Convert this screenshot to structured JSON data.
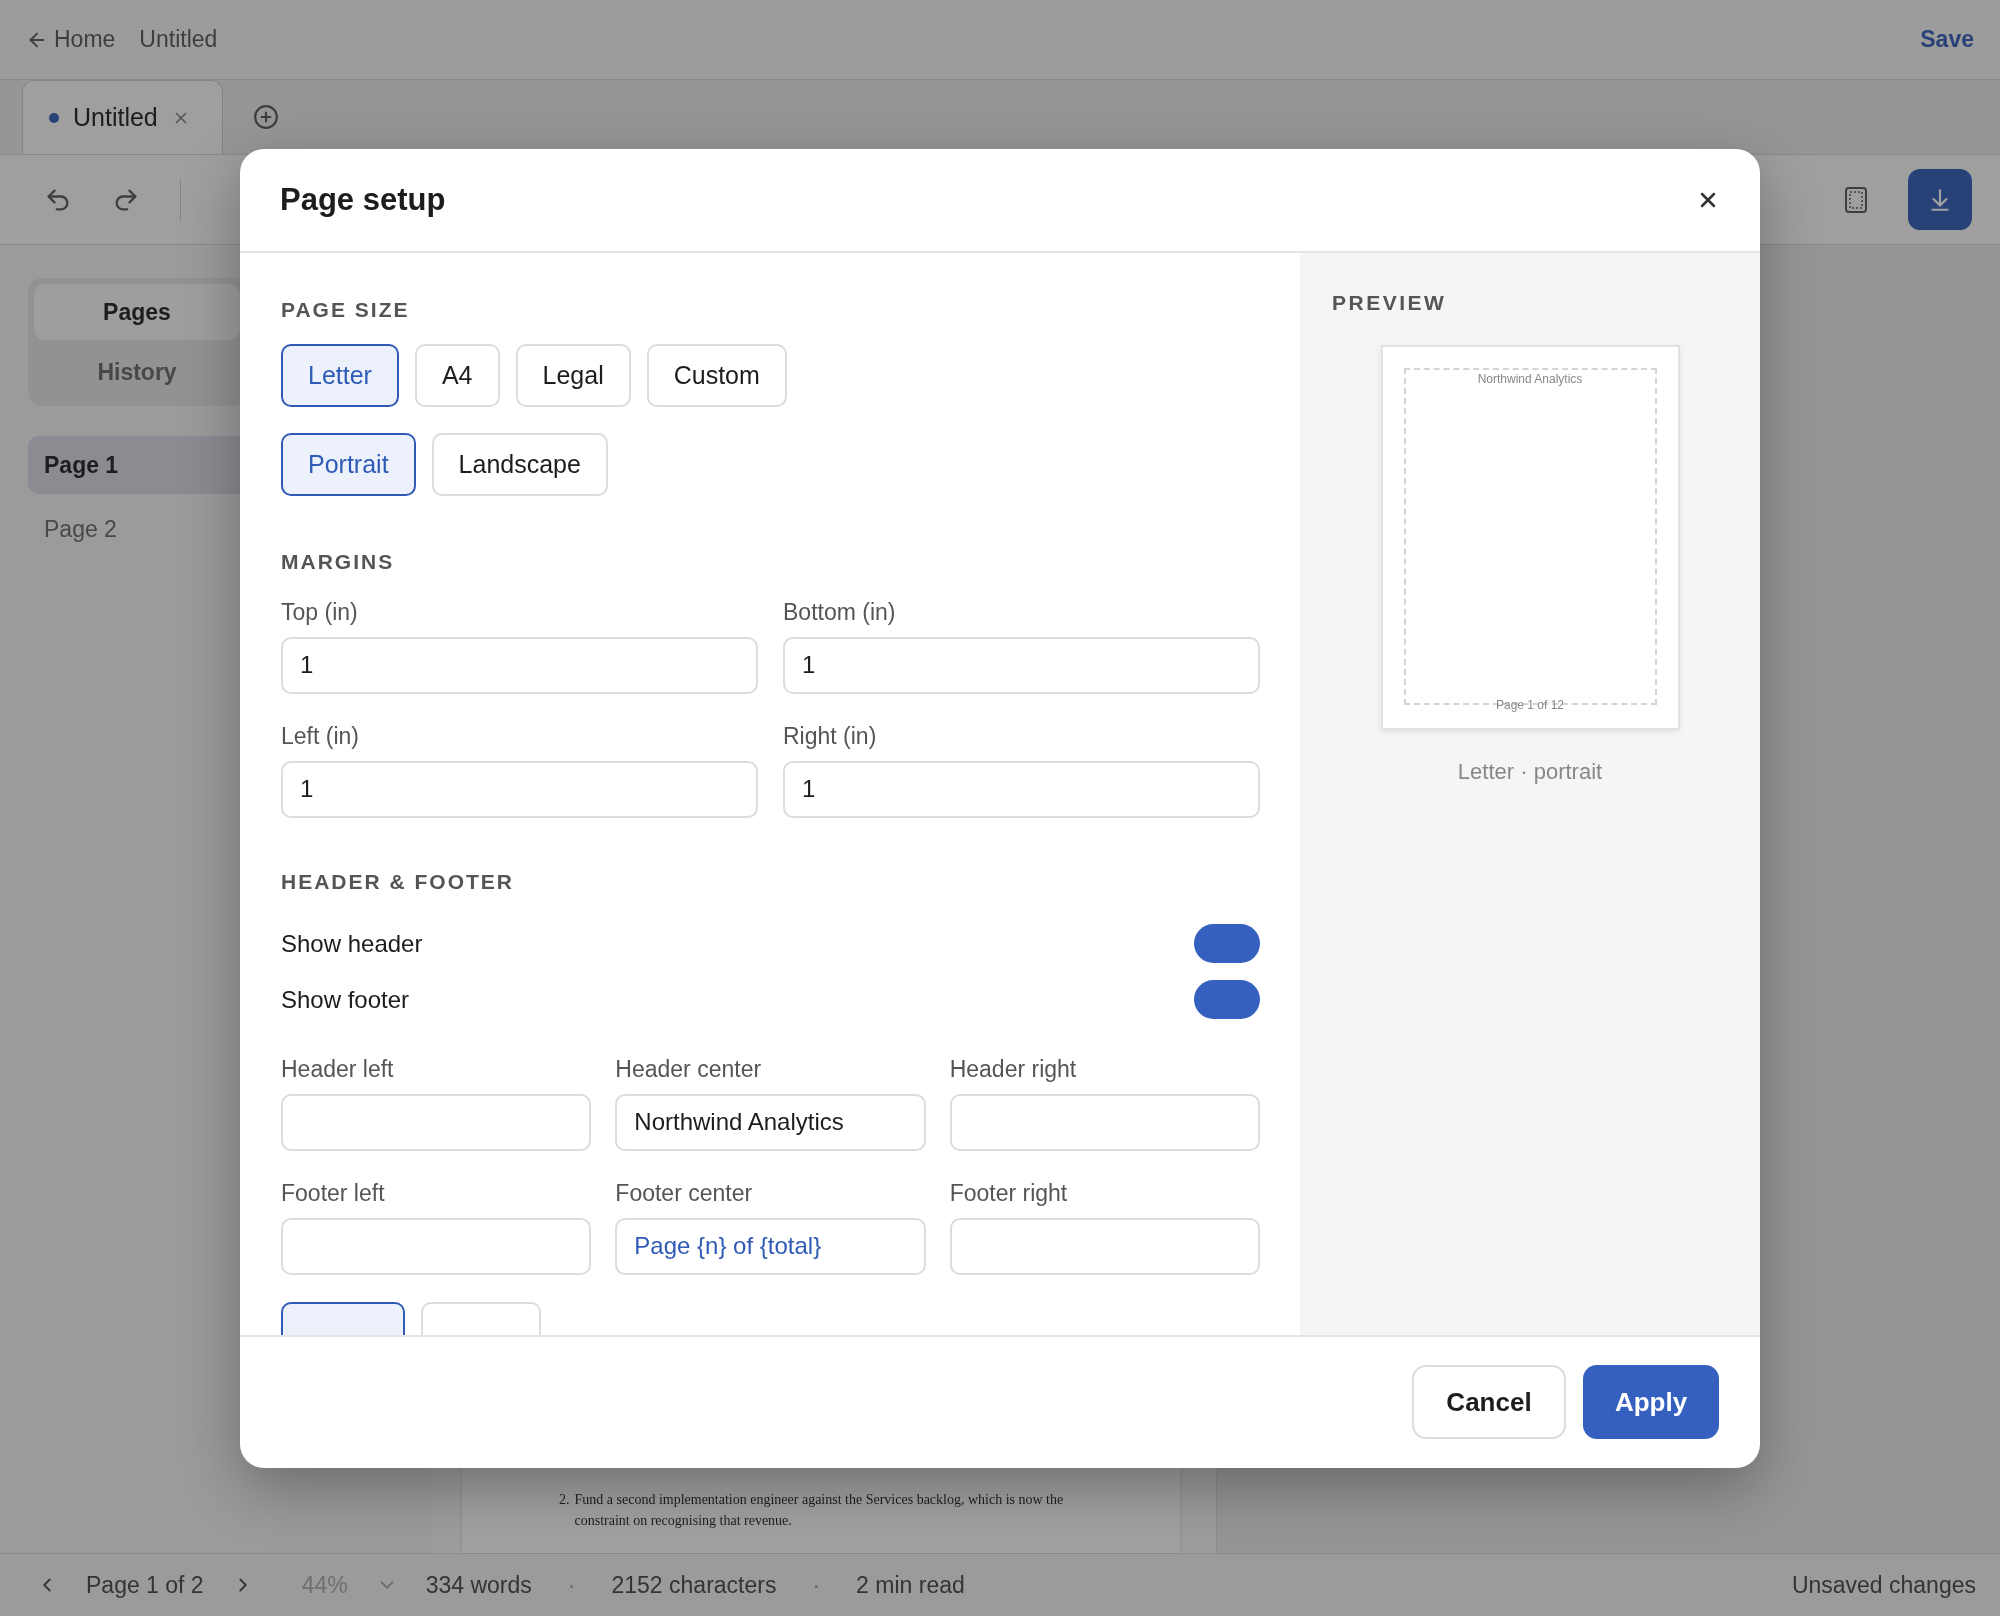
{
  "top_bar": {
    "back_label": "Home",
    "doc_title": "Untitled",
    "save": "Save"
  },
  "tabs": [
    {
      "label": "Untitled",
      "selected": true,
      "unsaved": true
    }
  ],
  "sidebar": {
    "tabs": [
      {
        "label": "Pages",
        "selected": true
      },
      {
        "label": "History",
        "selected": false
      }
    ],
    "pages": [
      {
        "label": "Page 1",
        "selected": true
      },
      {
        "label": "Page 2",
        "selected": false
      }
    ]
  },
  "document": {
    "list": [
      {
        "number": "2.",
        "text": "Fund a second implementation engineer against the Services backlog, which is now the constraint on recognising that revenue."
      }
    ]
  },
  "status_bar": {
    "page": "Page 1 of 2",
    "zoom": {
      "value": "44%",
      "disabled": true
    },
    "stats": [
      {
        "kind": "stat",
        "text": "334 words"
      },
      {
        "kind": "separator",
        "text": "·"
      },
      {
        "kind": "stat",
        "text": "2152 characters"
      },
      {
        "kind": "separator",
        "text": "·"
      },
      {
        "kind": "stat",
        "text": "2 min read"
      }
    ],
    "save_state": "Unsaved changes"
  },
  "dialog": {
    "title": "Page setup",
    "page_size": {
      "title": "PAGE SIZE",
      "sizes": [
        {
          "label": "Letter",
          "selected": true
        },
        {
          "label": "A4",
          "selected": false
        },
        {
          "label": "Legal",
          "selected": false
        },
        {
          "label": "Custom",
          "selected": false
        }
      ],
      "orientations": [
        {
          "label": "Portrait",
          "selected": true
        },
        {
          "label": "Landscape",
          "selected": false
        }
      ]
    },
    "margins": {
      "title": "MARGINS",
      "fields": [
        {
          "label": "Top (in)",
          "value": "1"
        },
        {
          "label": "Bottom (in)",
          "value": "1"
        },
        {
          "label": "Left (in)",
          "value": "1"
        },
        {
          "label": "Right (in)",
          "value": "1"
        }
      ]
    },
    "header_footer": {
      "title": "HEADER & FOOTER",
      "toggles": [
        {
          "label": "Show header",
          "on": true
        },
        {
          "label": "Show footer",
          "on": true
        }
      ],
      "fields": [
        {
          "label": "Header left",
          "kind": "text"
        },
        {
          "label": "Header center",
          "value": "Northwind Analytics",
          "kind": "text"
        },
        {
          "label": "Header right",
          "kind": "text"
        },
        {
          "label": "Footer left",
          "kind": "text"
        },
        {
          "label": "Footer center",
          "value": "Page {n} of {total}",
          "kind": "template"
        },
        {
          "label": "Footer right",
          "kind": "text"
        }
      ],
      "number_formats": [
        {
          "selected": true
        },
        {
          "selected": false
        }
      ]
    },
    "preview": {
      "title": "PREVIEW",
      "header_text": "Northwind Analytics",
      "footer_text": "Page 1 of 12",
      "caption": "Letter · portrait"
    },
    "buttons": {
      "cancel": "Cancel",
      "apply": "Apply"
    }
  }
}
